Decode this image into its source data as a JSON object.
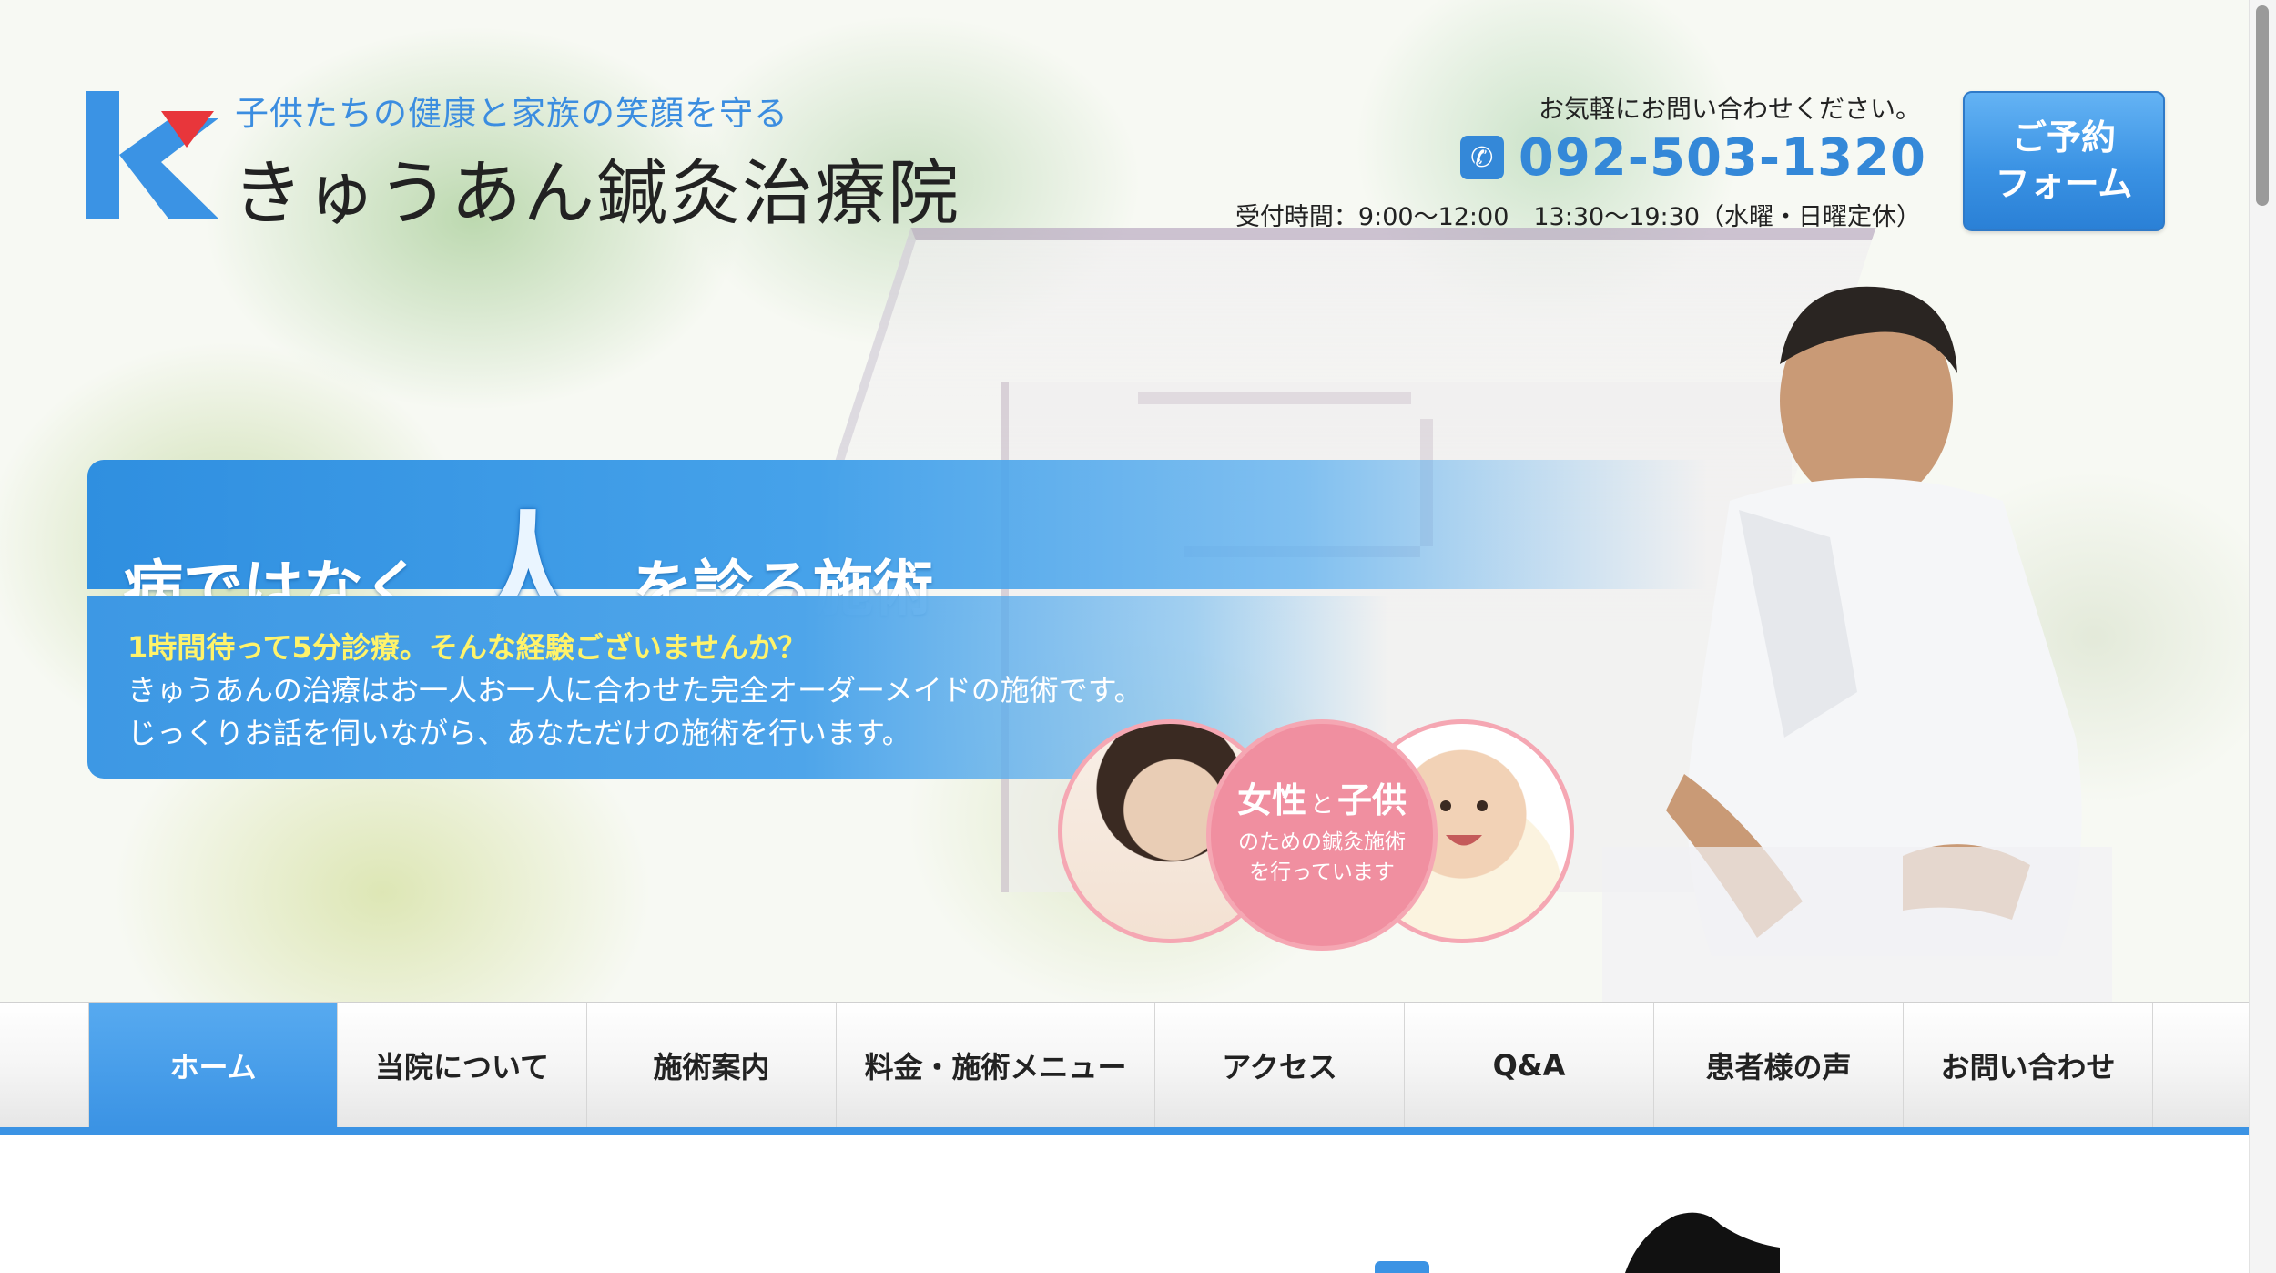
{
  "header": {
    "tagline": "子供たちの健康と家族の笑顔を守る",
    "site_name": "きゅうあん鍼灸治療院",
    "contact_note": "お気軽にお問い合わせください。",
    "phone": "092-503-1320",
    "hours": "受付時間：9:00～12:00　13:30～19:30（水曜・日曜定休）",
    "reserve_line1": "ご予約",
    "reserve_line2": "フォーム"
  },
  "banner": {
    "title_before": "病ではなく",
    "title_big": "人",
    "title_after": "を診る施術",
    "lead": "1時間待って5分診療。そんな経験ございませんか？",
    "line1": "きゅうあんの治療はお一人お一人に合わせた完全オーダーメイドの施術です。",
    "line2": "じっくりお話を伺いながら、あなただけの施術を行います。"
  },
  "circle": {
    "word1": "女性",
    "joiner": "と",
    "word2": "子供",
    "sub1": "のための鍼灸施術",
    "sub2": "を行っています"
  },
  "nav": {
    "items": [
      "ホーム",
      "当院について",
      "施術案内",
      "料金・施術メニュー",
      "アクセス",
      "Q&A",
      "患者様の声",
      "お問い合わせ"
    ]
  },
  "colors": {
    "brand_blue": "#3b93e4",
    "accent_red": "#e8363b",
    "highlight_yellow": "#fff36a",
    "pink": "#f08fa0"
  }
}
